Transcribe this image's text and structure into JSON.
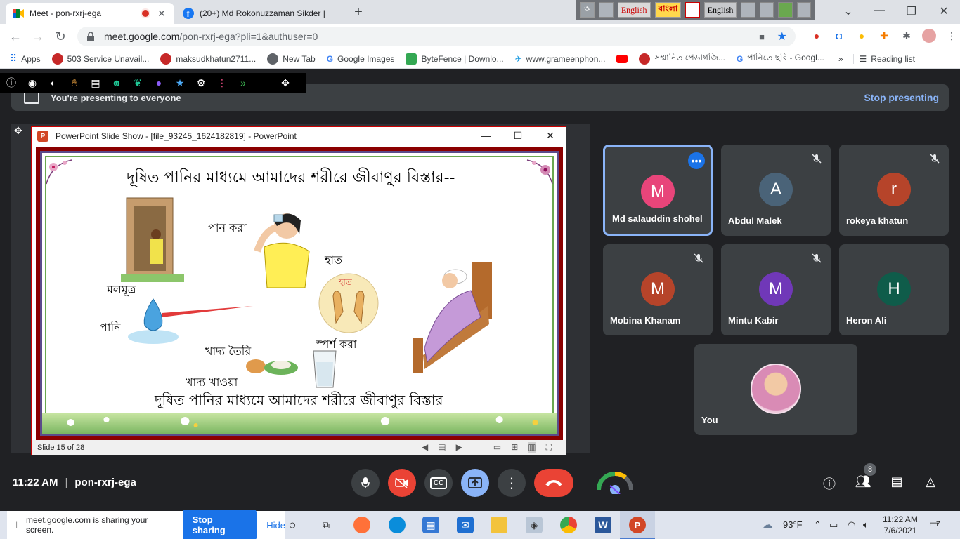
{
  "browser": {
    "tabs": [
      {
        "title": "Meet - pon-rxrj-ega",
        "active": true
      },
      {
        "title": "(20+) Md Rokonuzzaman Sikder |",
        "active": false
      }
    ],
    "url_host": "meet.google.com",
    "url_path": "/pon-rxrj-ega?pli=1&authuser=0",
    "lang_bar": {
      "item1": "English",
      "item2": "বাংলা",
      "item3": "English"
    },
    "bookmarks": [
      {
        "label": "Apps"
      },
      {
        "label": "503 Service Unavail..."
      },
      {
        "label": "maksudkhatun2711..."
      },
      {
        "label": "New Tab"
      },
      {
        "label": "Google Images"
      },
      {
        "label": "ByteFence | Downlo..."
      },
      {
        "label": "www.grameenphon..."
      },
      {
        "label": "সম্মানিত পেডাগজি..."
      },
      {
        "label": "পানিতে ছবি - Googl..."
      },
      {
        "label": "Reading list"
      }
    ],
    "more_bookmarks": "»"
  },
  "meet": {
    "presenting_text": "You're presenting to everyone",
    "stop_presenting": "Stop presenting",
    "time": "11:22 AM",
    "meeting_code": "pon-rxrj-ega",
    "participants_badge": "8",
    "participants": [
      {
        "initial": "M",
        "name": "Md salauddin shohel",
        "color": "#e8457a"
      },
      {
        "initial": "A",
        "name": "Abdul Malek",
        "color": "#4a6378"
      },
      {
        "initial": "r",
        "name": "rokeya khatun",
        "color": "#b6442a"
      },
      {
        "initial": "M",
        "name": "Mobina Khanam",
        "color": "#b6442a"
      },
      {
        "initial": "M",
        "name": "Mintu Kabir",
        "color": "#7038b8"
      },
      {
        "initial": "H",
        "name": "Heron Ali",
        "color": "#0f5c4a"
      },
      {
        "initial": "",
        "name": "You",
        "color": "#d98bb5"
      }
    ]
  },
  "powerpoint": {
    "title": "PowerPoint Slide Show - [file_93245_1624182819] - PowerPoint",
    "status": "Slide 15 of 28",
    "slide": {
      "heading": "দূষিত পানির মাধ্যমে আমাদের শরীরে জীবাণুর বিস্তার--",
      "footer": "দূষিত পানির মাধ্যমে আমাদের শরীরে জীবাণুর বিস্তার",
      "labels": {
        "drink": "পান করা",
        "hand": "হাত",
        "hand_inner": "হাত",
        "feces": "মলমূত্র",
        "water": "পানি",
        "cook": "খাদ্য তৈরি",
        "touch": "স্পর্শ করা",
        "eat": "খাদ্য খাওয়া"
      }
    }
  },
  "taskbar": {
    "share_text": "meet.google.com is sharing your screen.",
    "stop_sharing": "Stop sharing",
    "hide": "Hide",
    "weather": "93°F",
    "clock_time": "11:22 AM",
    "clock_date": "7/6/2021",
    "notifications": "7"
  }
}
